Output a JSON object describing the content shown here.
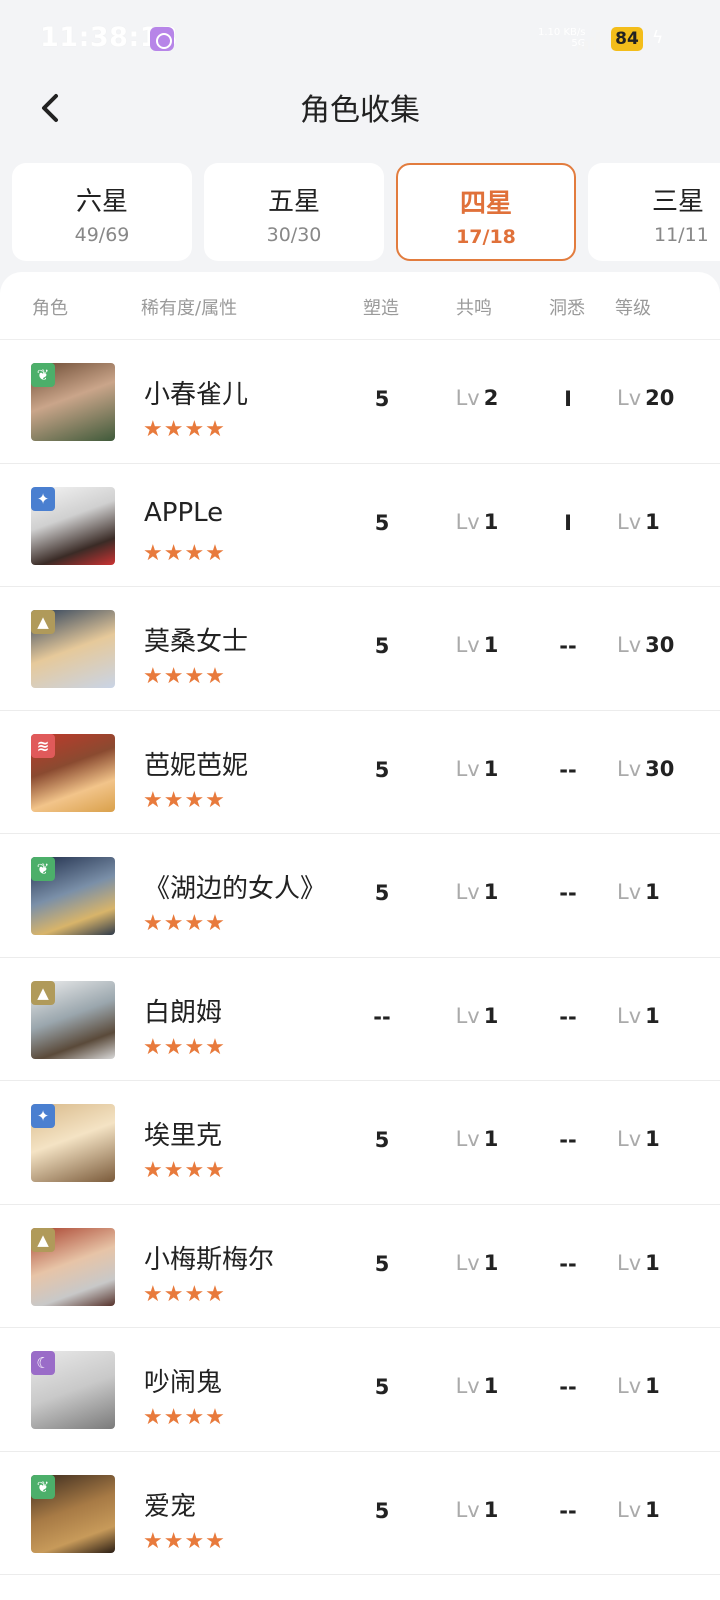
{
  "status": {
    "time": "11:38:13",
    "net": "1.10 KB/s",
    "net_type": "5G",
    "battery": "84",
    "charging_icon": "lightning-icon"
  },
  "header": {
    "title": "角色收集",
    "back_icon": "chevron-left-icon"
  },
  "tabs": [
    {
      "label": "六星",
      "count": "49/69"
    },
    {
      "label": "五星",
      "count": "30/30"
    },
    {
      "label": "四星",
      "count": "17/18"
    },
    {
      "label": "三星",
      "count": "11/11"
    }
  ],
  "active_tab": "四星",
  "table_header": {
    "character": "角色",
    "rarity": "稀有度/属性",
    "sculpt": "塑造",
    "resonance": "共鸣",
    "insight": "洞悉",
    "level": "等级"
  },
  "lv_prefix": "Lv",
  "rows": [
    {
      "name": "小春雀儿",
      "stars": "★★★★",
      "attribute": "plant-icon",
      "sculpt": "5",
      "resonance": "2",
      "insight": "I",
      "level": "20"
    },
    {
      "name": "APPLe",
      "stars": "★★★★",
      "attribute": "star-icon",
      "sculpt": "5",
      "resonance": "1",
      "insight": "I",
      "level": "1"
    },
    {
      "name": "莫桑女士",
      "stars": "★★★★",
      "attribute": "mineral-icon",
      "sculpt": "5",
      "resonance": "1",
      "insight": "--",
      "level": "30"
    },
    {
      "name": "芭妮芭妮",
      "stars": "★★★★",
      "attribute": "beast-icon",
      "sculpt": "5",
      "resonance": "1",
      "insight": "--",
      "level": "30"
    },
    {
      "name": "《湖边的女人》",
      "stars": "★★★★",
      "attribute": "plant-icon",
      "sculpt": "5",
      "resonance": "1",
      "insight": "--",
      "level": "1"
    },
    {
      "name": "白朗姆",
      "stars": "★★★★",
      "attribute": "mineral-icon",
      "sculpt": "--",
      "resonance": "1",
      "insight": "--",
      "level": "1"
    },
    {
      "name": "埃里克",
      "stars": "★★★★",
      "attribute": "star-icon",
      "sculpt": "5",
      "resonance": "1",
      "insight": "--",
      "level": "1"
    },
    {
      "name": "小梅斯梅尔",
      "stars": "★★★★",
      "attribute": "mineral-icon",
      "sculpt": "5",
      "resonance": "1",
      "insight": "--",
      "level": "1"
    },
    {
      "name": "吵闹鬼",
      "stars": "★★★★",
      "attribute": "spirit-icon",
      "sculpt": "5",
      "resonance": "1",
      "insight": "--",
      "level": "1"
    },
    {
      "name": "爱宠",
      "stars": "★★★★",
      "attribute": "plant-icon",
      "sculpt": "5",
      "resonance": "1",
      "insight": "--",
      "level": "1"
    }
  ],
  "colors": {
    "accent": "#e0713a",
    "star": "#e87a3c",
    "plant": "#4caf6a",
    "star_attr": "#4a7fd0",
    "mineral": "#b09a5a",
    "beast": "#e05a5a",
    "spirit": "#9a6cc8"
  }
}
